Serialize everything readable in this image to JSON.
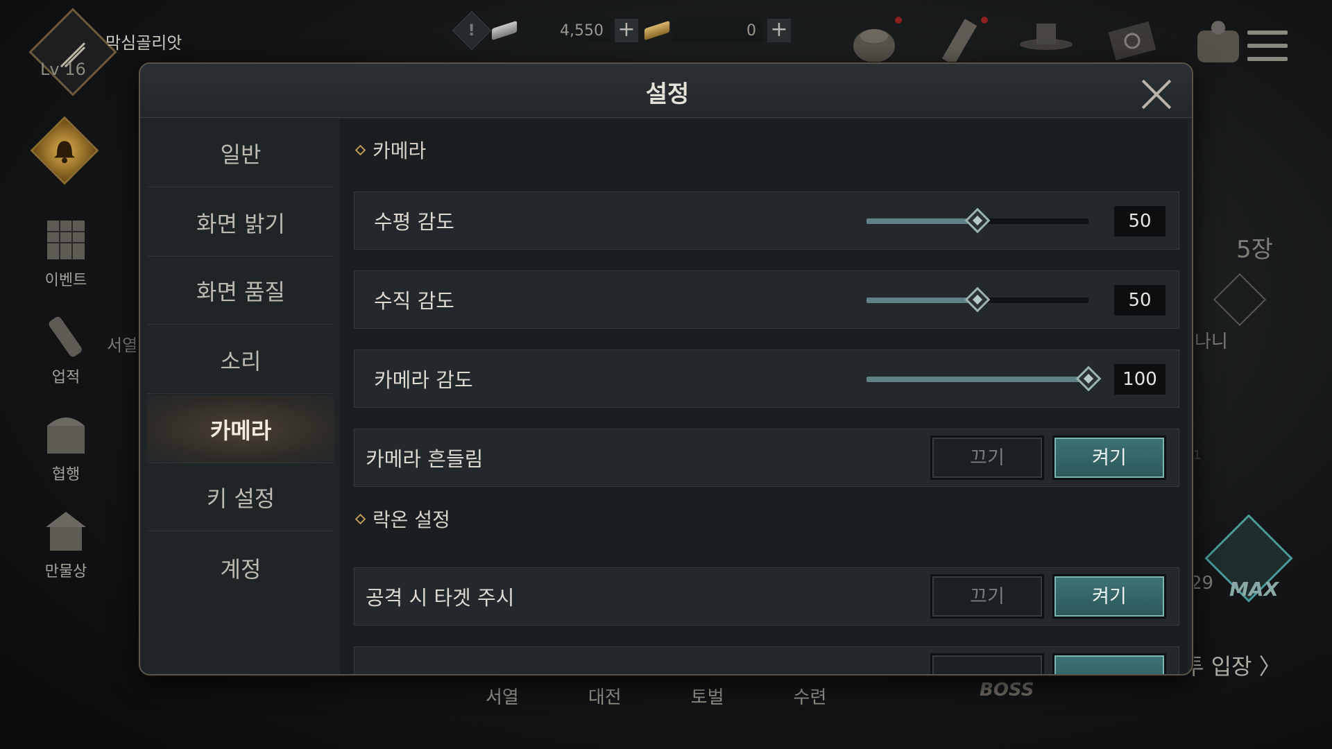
{
  "hud": {
    "player_name": "막심골리앗",
    "player_level": "Lv 16",
    "currencies": [
      {
        "name": "silver-ingot-icon",
        "value": "4,550"
      },
      {
        "name": "gold-ingot-icon",
        "value": "0"
      }
    ],
    "plus_label": "+",
    "alert_label": "!"
  },
  "left_menu": [
    {
      "label": "이벤트"
    },
    {
      "label": "업적"
    },
    {
      "label": "협행"
    },
    {
      "label": "만물상"
    }
  ],
  "background": {
    "left_partial": "서열",
    "right_count": "5장",
    "right_partial": "나니",
    "right_number": "29",
    "right_small": "1",
    "enter_label": "투 입장 〉",
    "max_label": "MAX",
    "boss_label": "BOSS",
    "bottom_tabs": [
      "서열",
      "대전",
      "토벌",
      "수련"
    ]
  },
  "modal": {
    "title": "설정",
    "sidebar": [
      {
        "label": "일반",
        "active": false
      },
      {
        "label": "화면 밝기",
        "active": false
      },
      {
        "label": "화면 품질",
        "active": false
      },
      {
        "label": "소리",
        "active": false
      },
      {
        "label": "카메라",
        "active": true
      },
      {
        "label": "키 설정",
        "active": false
      },
      {
        "label": "계정",
        "active": false
      }
    ],
    "sections": {
      "camera": "카메라",
      "lockon": "락온 설정"
    },
    "sliders": [
      {
        "label": "수평 감도",
        "value": 50,
        "max": 100
      },
      {
        "label": "수직 감도",
        "value": 50,
        "max": 100
      },
      {
        "label": "카메라 감도",
        "value": 100,
        "max": 100
      }
    ],
    "toggles": [
      {
        "label": "카메라 흔들림",
        "off_label": "끄기",
        "on_label": "켜기",
        "state": "on"
      },
      {
        "label": "공격 시 타겟 주시",
        "off_label": "끄기",
        "on_label": "켜기",
        "state": "on"
      }
    ]
  }
}
